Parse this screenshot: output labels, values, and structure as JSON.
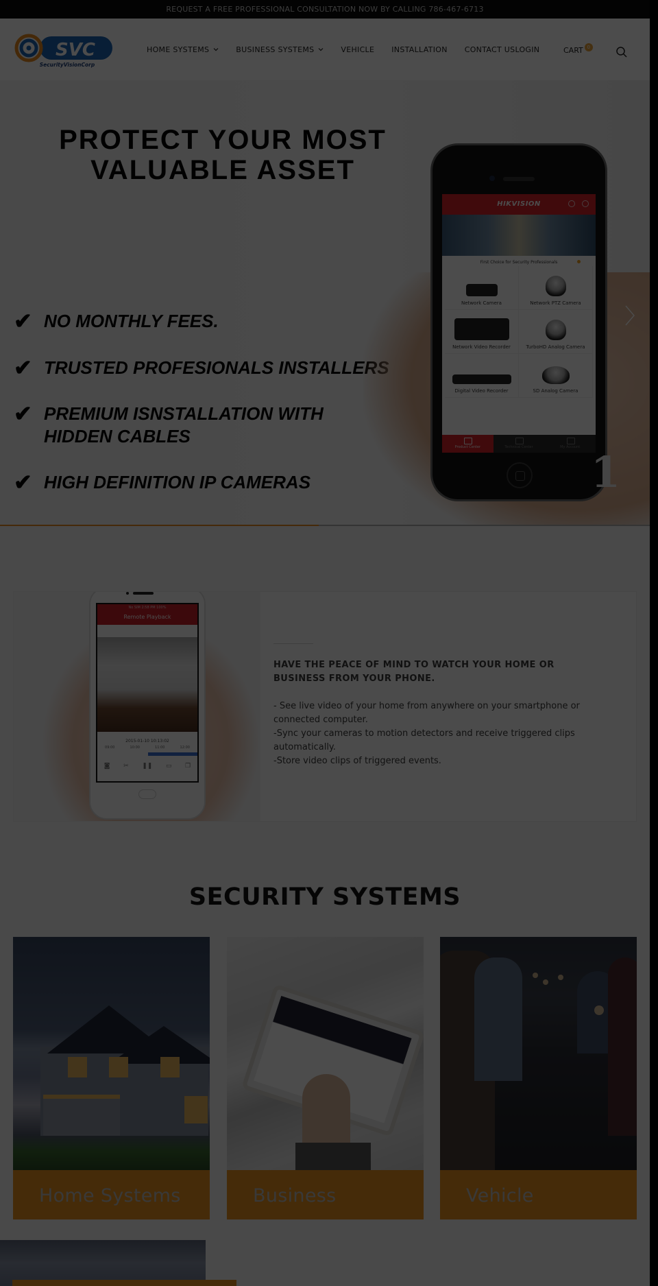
{
  "announcement": "REQUEST A FREE PROFESSIONAL CONSULTATION NOW BY CALLING 786-467-6713",
  "brand": {
    "logo_text": "SVC",
    "logo_tagline": "SecurityVisionCorp",
    "colors": {
      "blue": "#1d64b4",
      "orange": "#e8891e"
    }
  },
  "nav": {
    "items": [
      {
        "label": "HOME SYSTEMS",
        "has_dropdown": true
      },
      {
        "label": "BUSINESS SYSTEMS",
        "has_dropdown": true
      },
      {
        "label": "VEHICLE",
        "has_dropdown": false
      },
      {
        "label": "INSTALLATION",
        "has_dropdown": false
      },
      {
        "label": "CONTACT US",
        "has_dropdown": false
      },
      {
        "label": "LOGIN",
        "has_dropdown": false
      }
    ],
    "cart_label": "CART",
    "cart_count": "0",
    "search_icon": "search-icon"
  },
  "hero": {
    "title": "PROTECT YOUR MOST VALUABLE ASSET",
    "features": [
      "NO MONTHLY FEES.",
      "TRUSTED PROFESIONALS INSTALLERS",
      "PREMIUM ISNSTALLATION WITH",
      "HIDDEN CABLES",
      "HIGH DEFINITION IP CAMERAS"
    ],
    "slide_number": "1",
    "slide_progress_percent": 49,
    "phone_app": {
      "brand": "HIKVISION",
      "tagline": "First Choice for Security Professionals",
      "products": [
        "Network Camera",
        "Network PTZ Camera",
        "Network Video Recorder",
        "TurboHD Analog Camera",
        "Digital Video Recorder",
        "SD Analog Camera"
      ],
      "tabs": [
        "Product Center",
        "Technical Center",
        "My Account"
      ]
    }
  },
  "peace": {
    "heading": "HAVE THE PEACE OF MIND TO WATCH YOUR HOME OR BUSINESS FROM YOUR PHONE.",
    "bullets": [
      "- See live video of your home from anywhere on your smartphone or connected computer.",
      "-Sync your cameras to motion detectors and receive triggered clips automatically.",
      "-Store video clips of triggered events."
    ],
    "phone_app": {
      "status": "No SIM   2:58 PM   100%",
      "title": "Remote Playback",
      "datetime": "2015-01-10  10:13:02",
      "ticks": [
        "09:00",
        "10:00",
        "11:00",
        "12:00"
      ]
    }
  },
  "security_systems": {
    "title": "SECURITY SYSTEMS",
    "cards": [
      {
        "label": "Home Systems"
      },
      {
        "label": "Business"
      },
      {
        "label": "Vehicle"
      }
    ]
  }
}
